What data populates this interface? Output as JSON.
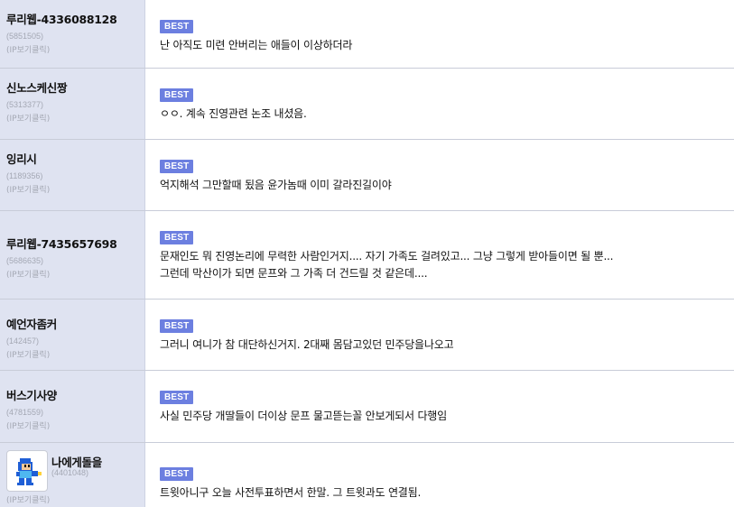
{
  "badge_label": "BEST",
  "colors": {
    "badge_bg": "#6c7fe0",
    "author_bg": "#dfe3f1",
    "muted_text": "#a4a8b4"
  },
  "comments": [
    {
      "nickname": "루리웹-4336088128",
      "user_id": "(5851505)",
      "ip_link": "(IP보기클릭)",
      "text": "난 아직도 미련 안버리는 애들이 이상하더라"
    },
    {
      "nickname": "신노스케신짱",
      "user_id": "(5313377)",
      "ip_link": "(IP보기클릭)",
      "text": "ㅇㅇ. 계속 진영관련 논조 내셨음."
    },
    {
      "nickname": "잉리시",
      "user_id": "(1189356)",
      "ip_link": "(IP보기클릭)",
      "text": "억지해석 그만할때 됬음 윤가놈때 이미 갈라진길이야"
    },
    {
      "nickname": "루리웹-7435657698",
      "user_id": "(5686635)",
      "ip_link": "(IP보기클릭)",
      "text": "문재인도 뭐 진영논리에 무력한 사람인거지.... 자기 가족도 걸려있고...  그냥 그렇게 받아들이면 될 뿐...\n그런데 막산이가 되면 문프와 그 가족 더 건드릴 것 같은데...."
    },
    {
      "nickname": "예언자좀커",
      "user_id": "(142457)",
      "ip_link": "(IP보기클릭)",
      "text": "그러니 여니가 참 대단하신거지. 2대째 몸담고있던 민주당을나오고"
    },
    {
      "nickname": "버스기사양",
      "user_id": "(4781559)",
      "ip_link": "(IP보기클릭)",
      "text": "사실 민주당 개딸들이 더이상 문프 물고뜯는꼴 안보게되서 다행임"
    },
    {
      "nickname": "나에게돌을",
      "user_id": "(4401048)",
      "ip_link": "(IP보기클릭)",
      "text": "트윗아니구 오늘 사전투표하면서 한말. 그 트윗과도 연결됨.",
      "avatar": "megaman-sprite-icon"
    }
  ]
}
